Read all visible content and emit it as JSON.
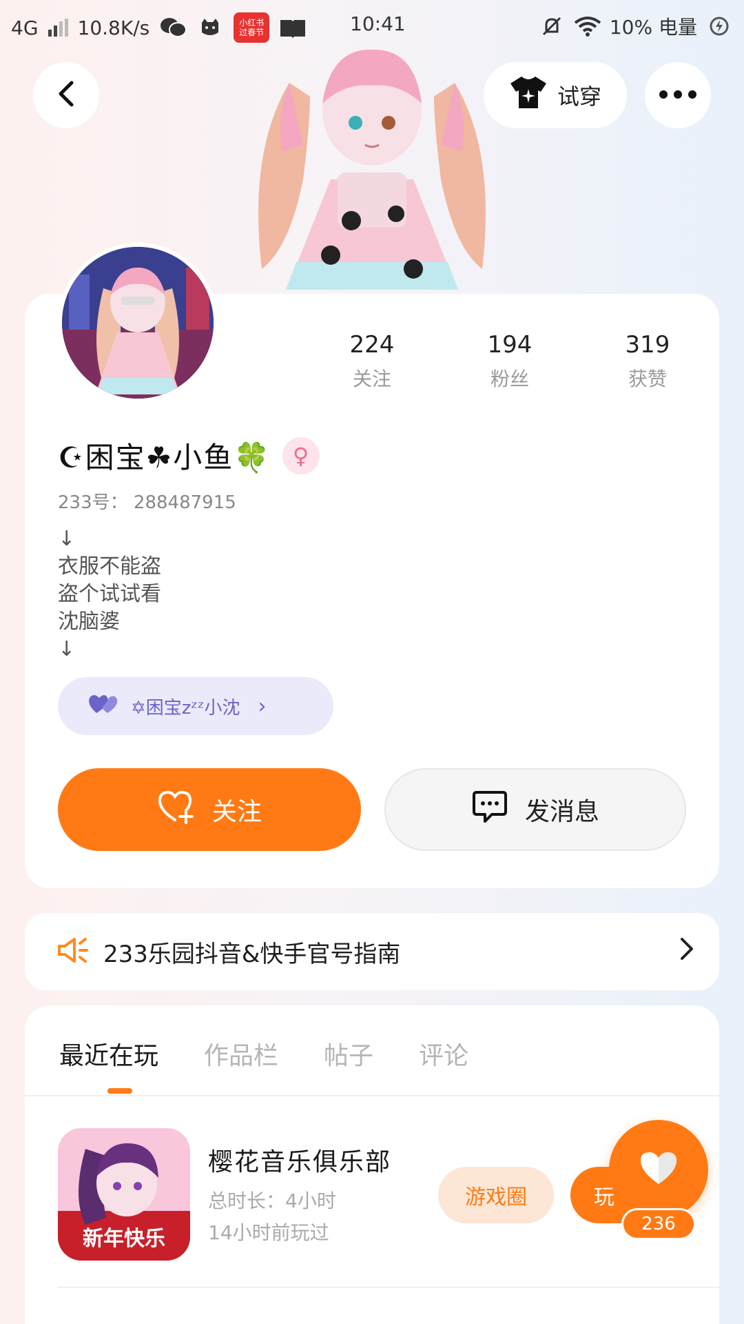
{
  "status_bar": {
    "network": "4G",
    "speed": "10.8K/s",
    "time": "10:41",
    "battery_text": "10% 电量",
    "app_badge_top": "小红书",
    "app_badge_bottom": "过春节"
  },
  "header": {
    "tryon_label": "试穿"
  },
  "profile": {
    "stats": [
      {
        "num": "224",
        "label": "关注"
      },
      {
        "num": "194",
        "label": "粉丝"
      },
      {
        "num": "319",
        "label": "获赞"
      }
    ],
    "nickname": "☪困宝☘小鱼🍀",
    "gender_symbol": "♀",
    "uid_label": "233号：",
    "uid_value": "288487915",
    "bio": "↓\n衣服不能盗\n盗个试试看\n沈脑婆\n↓",
    "family_tag": "✡困宝zᶻᶻ小沈",
    "follow_label": "关注",
    "message_label": "发消息"
  },
  "notice": {
    "text": "233乐园抖音&快手官号指南"
  },
  "tabs": [
    "最近在玩",
    "作品栏",
    "帖子",
    "评论"
  ],
  "games": [
    {
      "title": "樱花音乐俱乐部",
      "total_time": "总时长：4小时",
      "last_played": "14小时前玩过",
      "circle_label": "游戏圈",
      "play_label": "玩",
      "icon_text": "新年快乐"
    }
  ],
  "float_like": {
    "count": "236"
  },
  "colors": {
    "accent": "#ff7a14",
    "family_pill": "#ebeafa",
    "gender_pink": "#f06a8e"
  }
}
